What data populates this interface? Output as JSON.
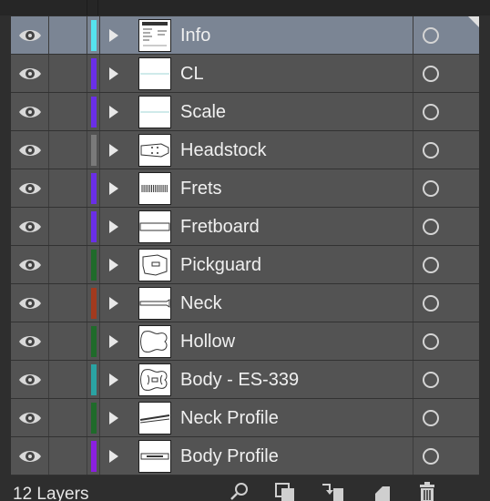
{
  "panel": {
    "layer_count_label": "12 Layers"
  },
  "layers": [
    {
      "name": "Info",
      "color": "#55e3ee",
      "selected": true,
      "thumb": "info"
    },
    {
      "name": "CL",
      "color": "#6a2ee8",
      "selected": false,
      "thumb": "hline"
    },
    {
      "name": "Scale",
      "color": "#6a2ee8",
      "selected": false,
      "thumb": "hline"
    },
    {
      "name": "Headstock",
      "color": "#7a7a7a",
      "selected": false,
      "thumb": "headstock"
    },
    {
      "name": "Frets",
      "color": "#6a2ee8",
      "selected": false,
      "thumb": "frets"
    },
    {
      "name": "Fretboard",
      "color": "#6a2ee8",
      "selected": false,
      "thumb": "fretboard"
    },
    {
      "name": "Pickguard",
      "color": "#1f6b2a",
      "selected": false,
      "thumb": "pickguard"
    },
    {
      "name": "Neck",
      "color": "#a23a1e",
      "selected": false,
      "thumb": "neck"
    },
    {
      "name": "Hollow",
      "color": "#1f6b2a",
      "selected": false,
      "thumb": "hollow"
    },
    {
      "name": "Body - ES-339",
      "color": "#2aa3a3",
      "selected": false,
      "thumb": "body"
    },
    {
      "name": "Neck Profile",
      "color": "#1f6b2a",
      "selected": false,
      "thumb": "neckprofile"
    },
    {
      "name": "Body Profile",
      "color": "#8b1fe0",
      "selected": false,
      "thumb": "bodyprofile"
    }
  ],
  "icons": {
    "visibility": "eye-icon",
    "expand": "disclosure-triangle-icon",
    "target": "target-circle-icon",
    "footer": [
      "locate-object-icon",
      "make-clipping-mask-icon",
      "create-sublayer-icon",
      "create-layer-icon",
      "delete-layer-icon"
    ]
  }
}
